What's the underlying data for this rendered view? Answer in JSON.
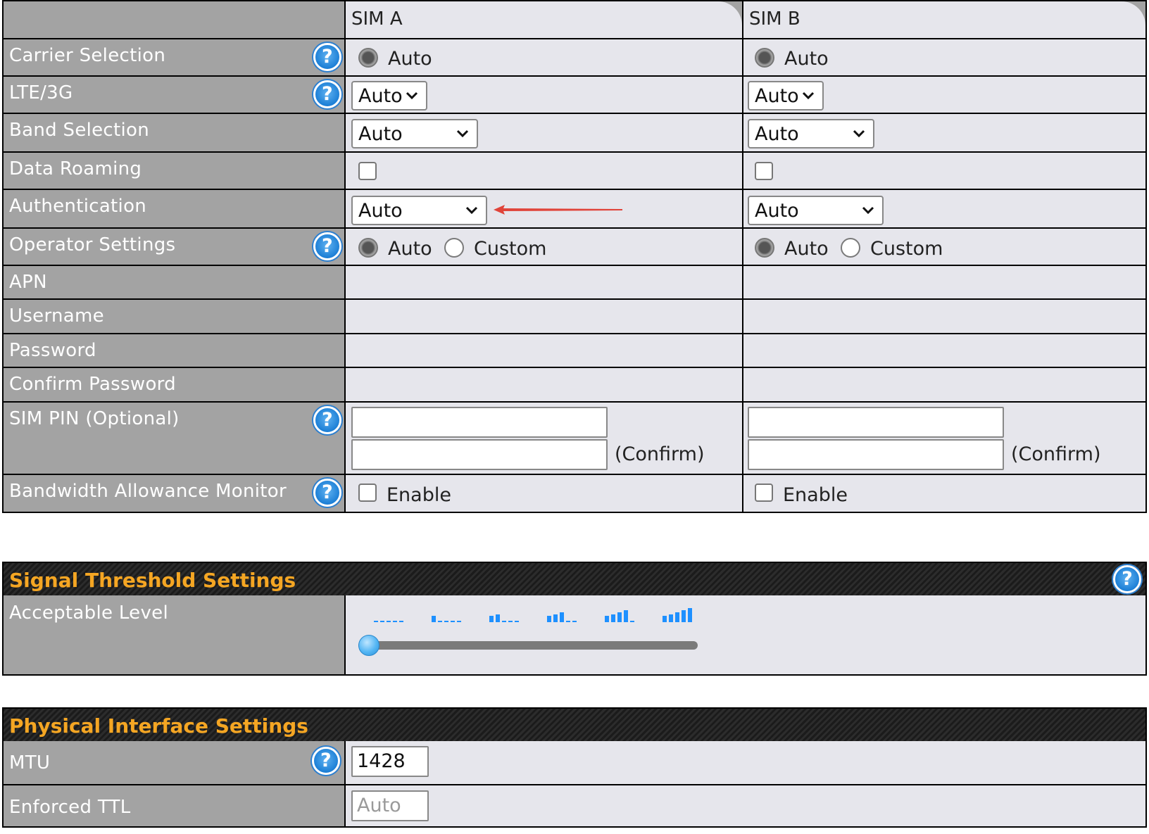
{
  "sim_table": {
    "columns": [
      "SIM A",
      "SIM B"
    ],
    "rows": {
      "carrier_selection": {
        "label": "Carrier Selection",
        "sim_a": "Auto",
        "sim_b": "Auto"
      },
      "lte_3g": {
        "label": "LTE/3G",
        "sim_a": "Auto",
        "sim_b": "Auto"
      },
      "band_selection": {
        "label": "Band Selection",
        "sim_a": "Auto",
        "sim_b": "Auto"
      },
      "data_roaming": {
        "label": "Data Roaming",
        "sim_a_checked": false,
        "sim_b_checked": false
      },
      "authentication": {
        "label": "Authentication",
        "sim_a": "Auto",
        "sim_b": "Auto"
      },
      "operator_settings": {
        "label": "Operator Settings",
        "option_auto": "Auto",
        "option_custom": "Custom",
        "sim_a_selected": "Auto",
        "sim_b_selected": "Auto"
      },
      "apn": {
        "label": "APN"
      },
      "username": {
        "label": "Username"
      },
      "password": {
        "label": "Password"
      },
      "confirm_password": {
        "label": "Confirm Password"
      },
      "sim_pin": {
        "label": "SIM PIN (Optional)",
        "confirm_label": "(Confirm)",
        "sim_a_pin": "",
        "sim_a_confirm": "",
        "sim_b_pin": "",
        "sim_b_confirm": ""
      },
      "bandwidth_monitor": {
        "label": "Bandwidth Allowance Monitor",
        "enable_label": "Enable",
        "sim_a_checked": false,
        "sim_b_checked": false
      }
    }
  },
  "signal_threshold": {
    "title": "Signal Threshold Settings",
    "acceptable_level_label": "Acceptable Level",
    "levels": 6,
    "selected_level": 0
  },
  "physical_interface": {
    "title": "Physical Interface Settings",
    "mtu_label": "MTU",
    "mtu_value": "1428",
    "ttl_label": "Enforced TTL",
    "ttl_placeholder": "Auto"
  },
  "colors": {
    "label_bg": "#a3a3a3",
    "cell_bg": "#e6e6ec",
    "section_title": "#f5a623",
    "help_icon": "#1c7fd6",
    "signal_bars": "#1e90ff",
    "annotation_arrow": "#e0443a"
  },
  "icons": {
    "help": "?",
    "select": "chevron-down-icon"
  }
}
